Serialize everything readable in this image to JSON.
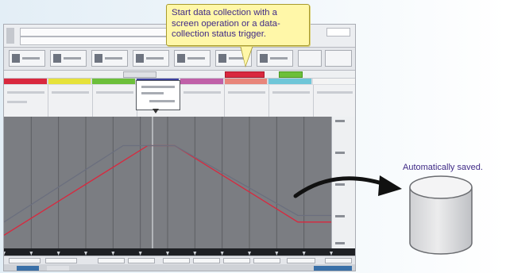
{
  "callout": {
    "line1": "Start data collection with a",
    "line2": "screen operation or a data-",
    "line3": "collection status trigger."
  },
  "storage": {
    "label": "Automatically saved."
  },
  "toolbar_button_count": 9,
  "color_strip": [
    "#d9283e",
    "#e6e23a",
    "#6cbf3a",
    "#3b3f9e",
    "#c060a8",
    "#e8857a",
    "#6fc6d8",
    "#f4f4f4"
  ],
  "chart_data": {
    "type": "line",
    "series": [
      {
        "color": "#d9283e",
        "x": [
          0,
          181,
          215,
          370,
          412
        ],
        "y": [
          0.1,
          0.78,
          0.78,
          0.2,
          0.2
        ]
      },
      {
        "color": "#6b6f7e",
        "x": [
          0,
          150,
          215,
          370,
          412
        ],
        "y": [
          0.2,
          0.78,
          0.78,
          0.25,
          0.25
        ]
      }
    ],
    "ylim": [
      0,
      1
    ],
    "grid": true
  },
  "colors": {
    "callout_bg": "#fff7a8",
    "text_accent": "#3f2a86",
    "plot_bg": "#7b7d82"
  }
}
